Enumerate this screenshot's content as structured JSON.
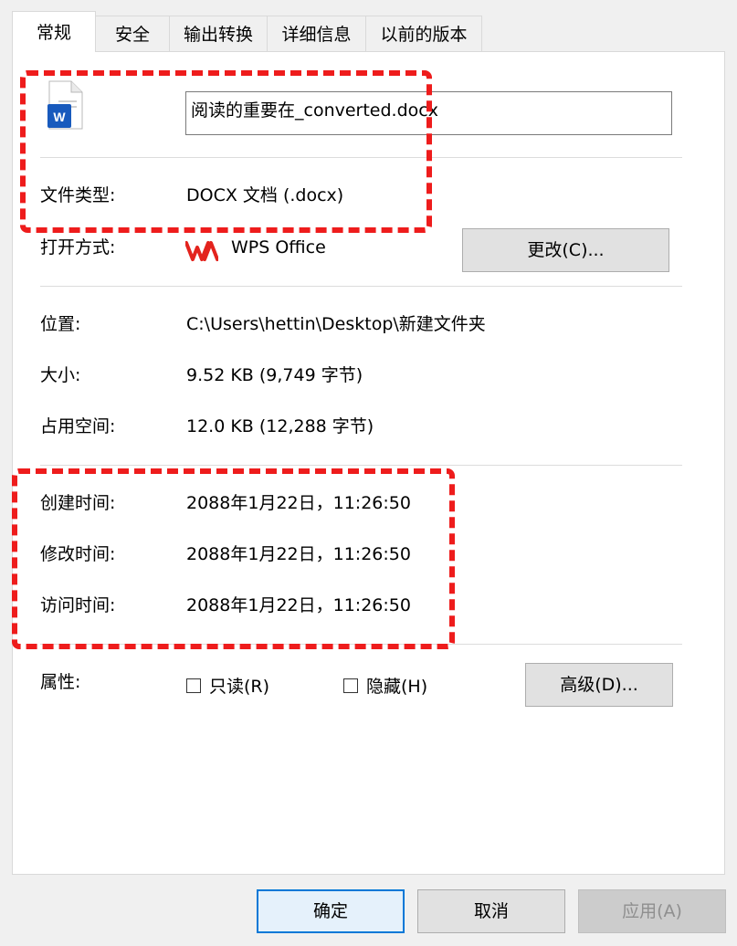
{
  "tabs": [
    {
      "label": "常规"
    },
    {
      "label": "安全"
    },
    {
      "label": "输出转换"
    },
    {
      "label": "详细信息"
    },
    {
      "label": "以前的版本"
    }
  ],
  "file": {
    "icon": "word-document-icon",
    "name": "阅读的重要在_converted.docx"
  },
  "rows": {
    "type_label": "文件类型:",
    "type_value": "DOCX 文档 (.docx)",
    "open_label": "打开方式:",
    "open_value": "WPS Office",
    "change_button": "更改(C)...",
    "location_label": "位置:",
    "location_value": "C:\\Users\\hettin\\Desktop\\新建文件夹",
    "size_label": "大小:",
    "size_value": "9.52 KB (9,749 字节)",
    "disk_label": "占用空间:",
    "disk_value": "12.0 KB (12,288 字节)",
    "created_label": "创建时间:",
    "created_value": "2088年1月22日，11:26:50",
    "modified_label": "修改时间:",
    "modified_value": "2088年1月22日，11:26:50",
    "accessed_label": "访问时间:",
    "accessed_value": "2088年1月22日，11:26:50",
    "attr_label": "属性:",
    "readonly_label": "只读(R)",
    "hidden_label": "隐藏(H)",
    "advanced_button": "高级(D)..."
  },
  "footer": {
    "ok": "确定",
    "cancel": "取消",
    "apply": "应用(A)"
  },
  "colors": {
    "highlight": "#ee1c1c",
    "word_blue": "#185abd",
    "wps_red": "#e3231d"
  }
}
